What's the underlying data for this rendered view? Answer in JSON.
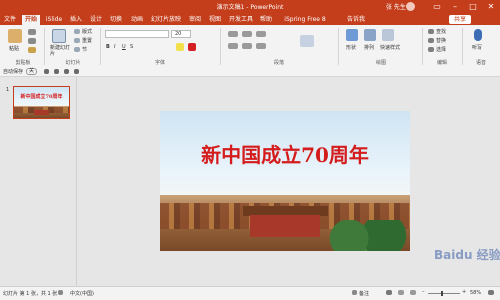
{
  "window": {
    "title": "演示文稿1 - PowerPoint",
    "user": "张 先生",
    "colors": {
      "accent": "#c43e1c",
      "ribbon_bg": "#f3f3f3",
      "headline": "#d41c1c"
    }
  },
  "tabs": [
    "文件",
    "开始",
    "iSlide",
    "插入",
    "设计",
    "切换",
    "动画",
    "幻灯片放映",
    "审阅",
    "视图",
    "开发工具",
    "帮助",
    "iSpring Free 8",
    "告诉我"
  ],
  "share_label": "共享",
  "ribbon": {
    "groups": [
      {
        "label": "剪贴板",
        "items": [
          "粘贴"
        ]
      },
      {
        "label": "幻灯片",
        "items": [
          "新建幻灯片",
          "版式",
          "重置",
          "节"
        ]
      },
      {
        "label": "字体",
        "items": []
      },
      {
        "label": "段落",
        "items": []
      },
      {
        "label": "绘图",
        "items": [
          "形状",
          "排列",
          "快速样式"
        ]
      },
      {
        "label": "编辑",
        "items": [
          "查找",
          "替换",
          "选择"
        ]
      },
      {
        "label": "语音",
        "items": [
          "听写"
        ]
      }
    ],
    "font_size": "20",
    "bold": "B",
    "italic": "I",
    "underline": "U",
    "strike": "S"
  },
  "qat": {
    "autosave": "自动保存",
    "toggle": "关"
  },
  "slide": {
    "number": "1",
    "headline": "新中国成立70周年"
  },
  "status": {
    "slide_count": "幻灯片 第 1 张，共 1 张",
    "language": "中文(中国)",
    "notes": "备注",
    "zoom": "58%"
  },
  "watermark": "Baidu 经验"
}
